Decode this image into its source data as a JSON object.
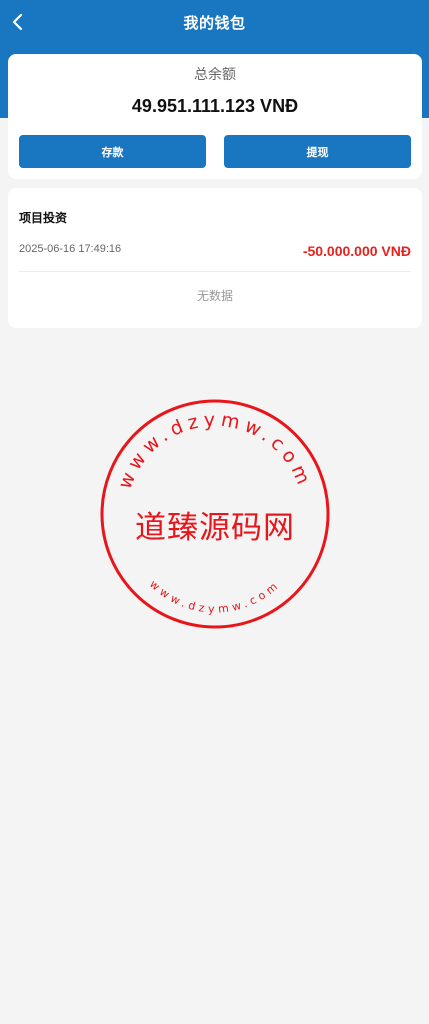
{
  "header": {
    "title": "我的钱包",
    "back_icon": "chevron-left-icon"
  },
  "balance": {
    "label": "总余额",
    "amount": "49.951.111.123 VNĐ"
  },
  "actions": {
    "deposit_label": "存款",
    "withdraw_label": "提现"
  },
  "records": {
    "title": "项目投资",
    "items": [
      {
        "time": "2025-06-16 17:49:16",
        "amount": "-50.000.000 VNĐ"
      }
    ],
    "empty_text": "无数据"
  },
  "stamp": {
    "name": "道臻源码网",
    "url": "www.dzymw.com"
  },
  "colors": {
    "primary": "#1976c0",
    "negative_amount": "#e8221f",
    "stamp": "#e8161b",
    "background": "#f4f4f4"
  }
}
